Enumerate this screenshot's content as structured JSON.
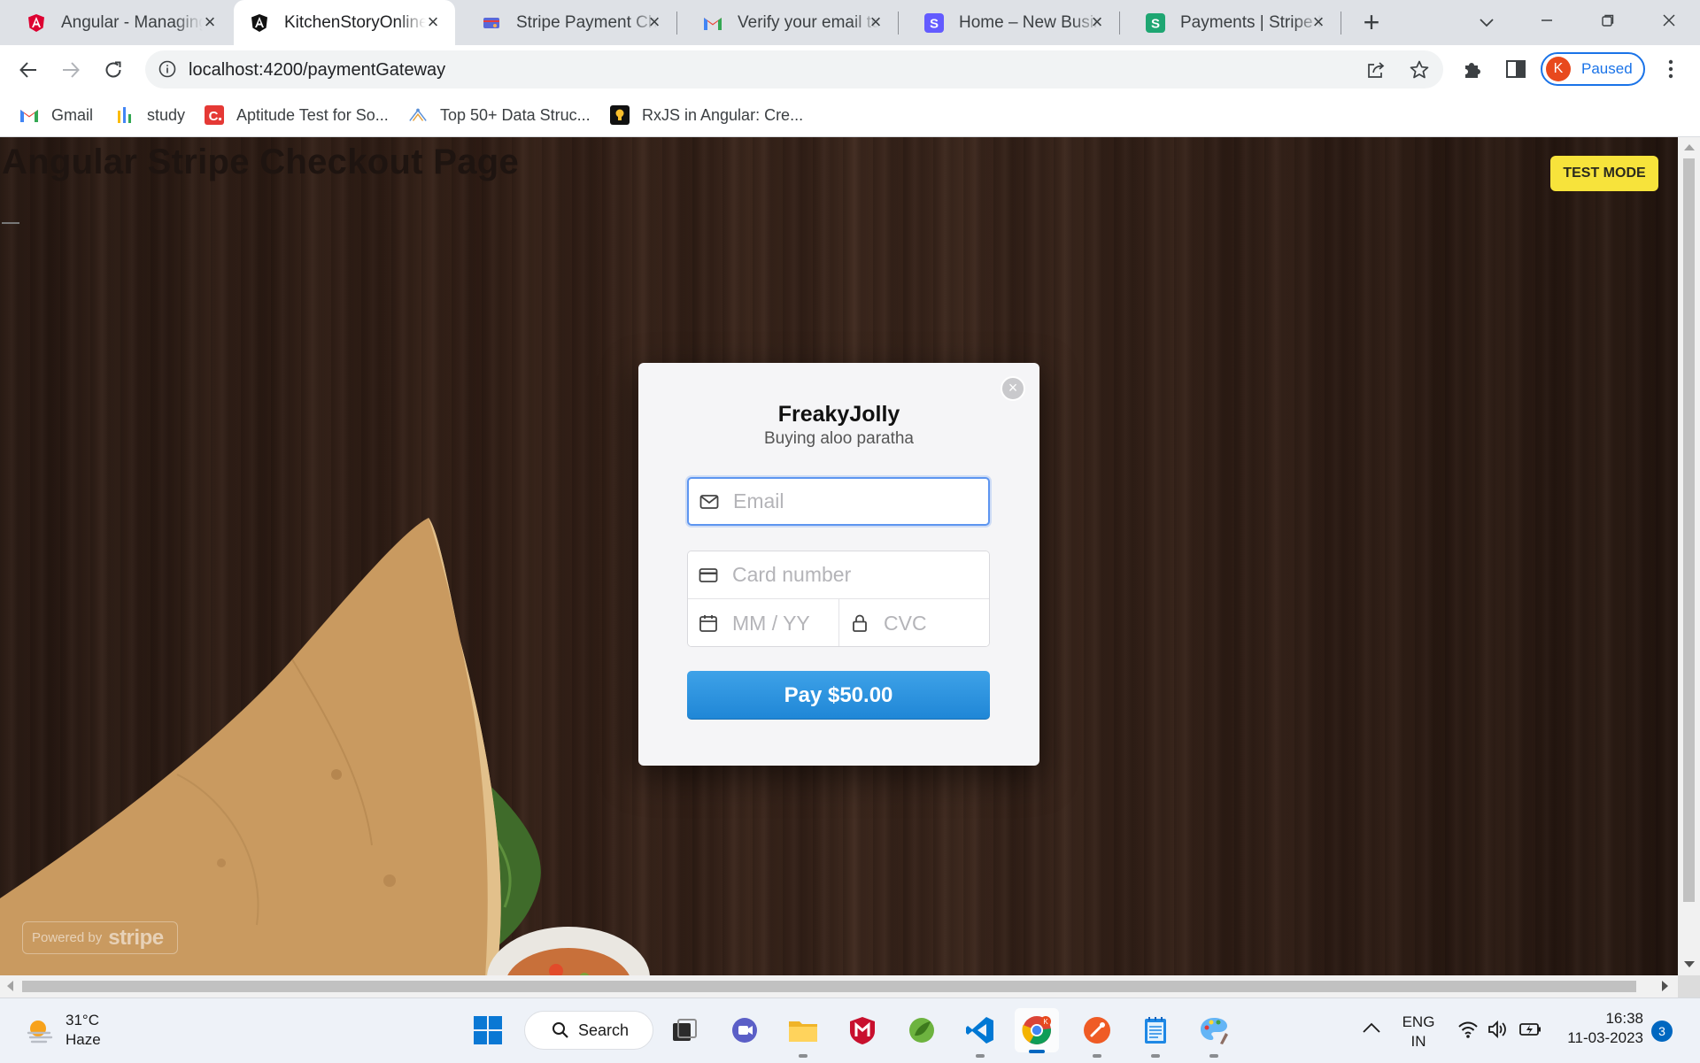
{
  "browser": {
    "tabs": [
      {
        "title": "Angular - Managing",
        "icon": "angular-red-icon",
        "active": false
      },
      {
        "title": "KitchenStoryOnline",
        "icon": "angular-black-icon",
        "active": true
      },
      {
        "title": "Stripe Payment Che",
        "icon": "stripe-checkout-icon",
        "active": false
      },
      {
        "title": "Verify your email to",
        "icon": "gmail-icon",
        "active": false
      },
      {
        "title": "Home – New Busine",
        "icon": "stripe-s-icon",
        "active": false
      },
      {
        "title": "Payments | Stripe D",
        "icon": "stripe-green-s-icon",
        "active": false
      }
    ],
    "url_host": "localhost",
    "url_rest": ":4200/paymentGateway",
    "profile_initial": "K",
    "profile_status": "Paused",
    "bookmarks": [
      {
        "label": "Gmail",
        "icon": "gmail-icon"
      },
      {
        "label": "study",
        "icon": "study-icon"
      },
      {
        "label": "Aptitude Test for So...",
        "icon": "aptitude-icon"
      },
      {
        "label": "Top 50+ Data Struc...",
        "icon": "data-struct-icon"
      },
      {
        "label": "RxJS in Angular: Cre...",
        "icon": "rxjs-bulb-icon"
      }
    ]
  },
  "page": {
    "heading": "Angular Stripe Checkout Page",
    "test_mode": "TEST MODE",
    "powered_by": "Powered by",
    "powered_brand": "stripe"
  },
  "checkout": {
    "business": "FreakyJolly",
    "description": "Buying aloo paratha",
    "email_placeholder": "Email",
    "card_number_placeholder": "Card number",
    "expiry_placeholder": "MM / YY",
    "cvc_placeholder": "CVC",
    "pay_label": "Pay $50.00",
    "accent": "#2a93e0"
  },
  "taskbar": {
    "weather_temp": "31°C",
    "weather_desc": "Haze",
    "search_label": "Search",
    "lang_1": "ENG",
    "lang_2": "IN",
    "time": "16:38",
    "date": "11-03-2023",
    "notification_count": "3"
  }
}
